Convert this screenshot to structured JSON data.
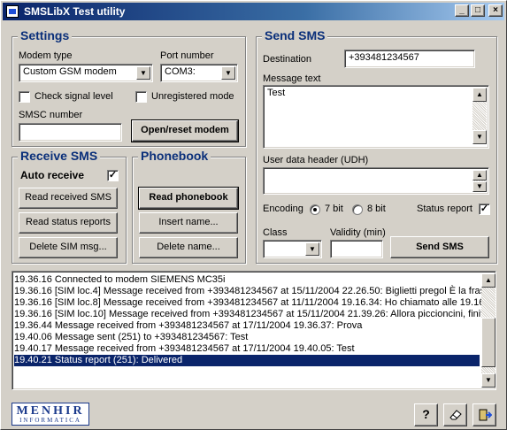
{
  "window": {
    "title": "SMSLibX Test utility"
  },
  "settings": {
    "title": "Settings",
    "modem_type_label": "Modem type",
    "modem_type_value": "Custom GSM modem",
    "port_label": "Port number",
    "port_value": "COM3:",
    "check_signal_label": "Check signal level",
    "unregistered_label": "Unregistered mode",
    "smsc_label": "SMSC number",
    "smsc_value": "",
    "open_reset_label": "Open/reset modem"
  },
  "receive": {
    "title": "Receive SMS",
    "auto_receive_label": "Auto receive",
    "auto_receive_checked": "✓",
    "read_received_label": "Read received SMS",
    "read_status_label": "Read status reports",
    "delete_sim_label": "Delete SIM msg..."
  },
  "phonebook": {
    "title": "Phonebook",
    "read_label": "Read phonebook",
    "insert_label": "Insert name...",
    "delete_label": "Delete name..."
  },
  "send": {
    "title": "Send SMS",
    "destination_label": "Destination",
    "destination_value": "+393481234567",
    "message_label": "Message text",
    "message_value": "Test",
    "udh_label": "User data header (UDH)",
    "udh_value": "",
    "encoding_label": "Encoding",
    "enc_7bit": "7 bit",
    "enc_8bit": "8 bit",
    "status_report_label": "Status report",
    "status_report_checked": "✓",
    "class_label": "Class",
    "class_value": "",
    "validity_label": "Validity (min)",
    "validity_value": "",
    "send_label": "Send SMS"
  },
  "log": {
    "lines": [
      "19.36.16  Connected to modem SIEMENS MC35i",
      "19.36.16  [SIM loc.4] Message received  from +393481234567 at 15/11/2004 22.26.50: Biglietti pregol È la fras",
      "19.36.16  [SIM loc.8] Message received  from +393481234567 at 11/11/2004 19.16.34: Ho chiamato alle 19.16",
      "19.36.16  [SIM loc.10] Message received  from +393481234567 at 15/11/2004 21.39.26: Allora piccioncini, finit",
      "19.36.44  Message received  from +393481234567 at 17/11/2004 19.36.37: Prova",
      "19.40.06  Message sent (251) to +393481234567: Test",
      "19.40.17  Message received  from +393481234567 at 17/11/2004 19.40.05: Test",
      "19.40.21  Status report (251): Delivered"
    ]
  },
  "footer": {
    "logo_line1": "MENHIR",
    "logo_line2": "INFORMATICA",
    "help_label": "?"
  },
  "icons": [
    "app-icon",
    "minimize-icon",
    "maximize-icon",
    "close-icon",
    "help-icon",
    "eraser-icon",
    "exit-icon",
    "chevron-down-icon",
    "scroll-up-icon",
    "scroll-down-icon"
  ],
  "colors": {
    "title_gradient_start": "#0a246a",
    "group_title": "#0a2f7a",
    "selection": "#0a246a",
    "logo": "#1b3a8c"
  }
}
